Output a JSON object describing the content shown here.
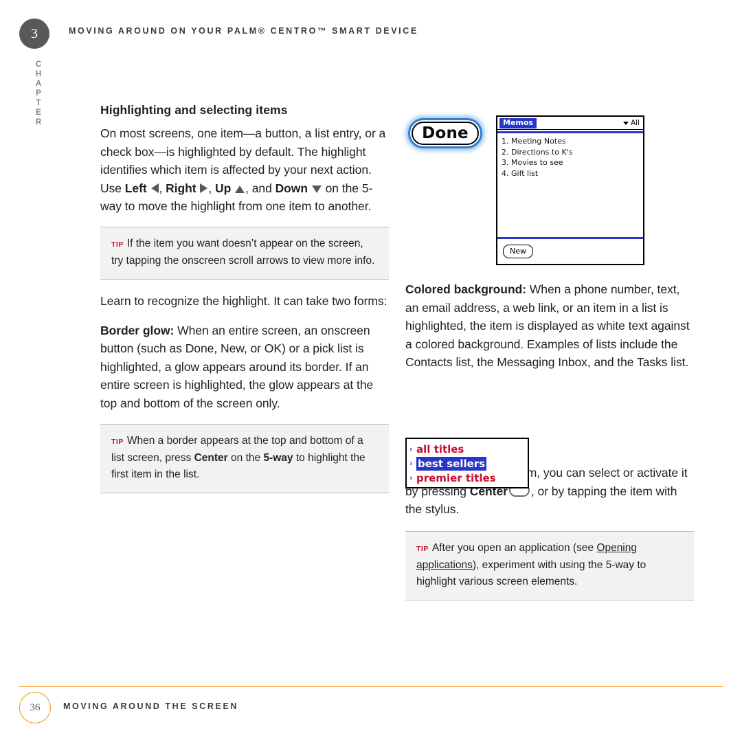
{
  "header": {
    "chapter_number": "3",
    "chapter_word": "CHAPTER",
    "title": "MOVING AROUND ON YOUR PALM® CENTRO™ SMART DEVICE"
  },
  "left_column": {
    "section_heading": "Highlighting and selecting items",
    "paragraph_1_a": "On most screens, one item—a button, a list entry, or a check box—is highlighted by default. The highlight identifies which item is affected by your next action. Use ",
    "paragraph_1_left": "Left",
    "paragraph_1_right": "Right",
    "paragraph_1_up": "Up",
    "paragraph_1_and": ", and ",
    "paragraph_1_down": "Down",
    "paragraph_1_b": " on the 5-way to move the highlight from one item to another.",
    "tip_1_label": "TIP",
    "tip_1_text": "If the item you want doesn’t appear on the screen, try tapping the onscreen scroll arrows to view more info.",
    "paragraph_2": "Learn to recognize the highlight. It can take two forms:",
    "paragraph_3_bold": "Border glow:",
    "paragraph_3_text": " When an entire screen, an onscreen button (such as Done, New, or OK) or a pick list is highlighted, a glow appears around its border. If an entire screen is highlighted, the glow appears at the top and bottom of the screen only.",
    "tip_2_label": "TIP",
    "tip_2_text_a": "When a border appears at the top and bottom of a list screen, press ",
    "tip_2_center": "Center",
    "tip_2_text_b": " on the ",
    "tip_2_fiveway": "5-way",
    "tip_2_text_c": " to highlight the first item in the list."
  },
  "right_column": {
    "paragraph_1_bold": "Colored background:",
    "paragraph_1_text": " When a phone number, text, an email address, a web link, or an item in a list is highlighted, the item is displayed as white text against a colored background. Examples of lists include the Contacts list, the Messaging Inbox, and the Tasks list.",
    "paragraph_2_a": "After highlighting an item, you can select or activate it by pressing ",
    "paragraph_2_center": "Center",
    "paragraph_2_b": ", or by tapping the item with the stylus.",
    "tip_label": "TIP",
    "tip_text_a": "After you open an application (see ",
    "tip_link": "Opening applications",
    "tip_text_b": "), experiment with using the 5-way to highlight various screen elements."
  },
  "graphics": {
    "done_button_label": "Done",
    "memos": {
      "title": "Memos",
      "category": "All",
      "items": [
        "1. Meeting Notes",
        "2. Directions to K's",
        "3. Movies to see",
        "4. Gift list"
      ],
      "new_button_label": "New"
    },
    "titles_list": {
      "rows": [
        {
          "label": "all titles",
          "selected": false
        },
        {
          "label": "best sellers",
          "selected": true
        },
        {
          "label": "premier titles",
          "selected": false
        }
      ]
    }
  },
  "footer": {
    "page_number": "36",
    "title": "MOVING AROUND THE SCREEN"
  },
  "colors": {
    "accent_orange": "#f7941d",
    "tip_red": "#c8102e",
    "screen_blue": "#2736c9",
    "glow_blue": "#2c7fd1",
    "badge_gray": "#58585a"
  }
}
